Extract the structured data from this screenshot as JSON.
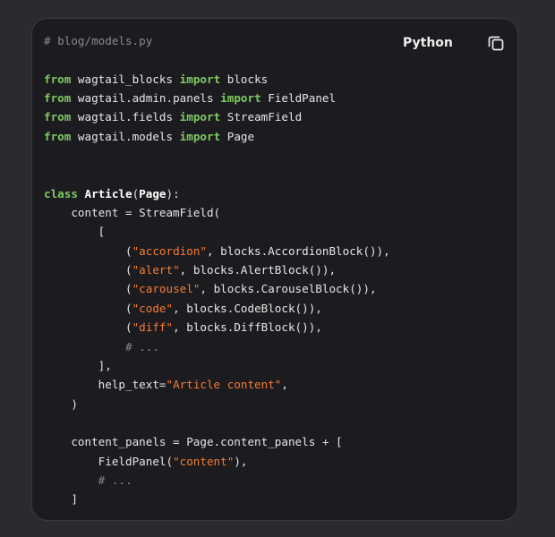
{
  "header": {
    "language": "Python",
    "copy_icon": "copy-icon"
  },
  "code": {
    "lines": [
      [
        {
          "t": "# blog/models.py",
          "k": "com"
        }
      ],
      [],
      [
        {
          "t": "from",
          "k": "kw"
        },
        {
          "t": " wagtail_blocks ",
          "k": "txt"
        },
        {
          "t": "import",
          "k": "kw"
        },
        {
          "t": " blocks",
          "k": "txt"
        }
      ],
      [
        {
          "t": "from",
          "k": "kw"
        },
        {
          "t": " wagtail.admin.panels ",
          "k": "txt"
        },
        {
          "t": "import",
          "k": "kw"
        },
        {
          "t": " FieldPanel",
          "k": "txt"
        }
      ],
      [
        {
          "t": "from",
          "k": "kw"
        },
        {
          "t": " wagtail.fields ",
          "k": "txt"
        },
        {
          "t": "import",
          "k": "kw"
        },
        {
          "t": " StreamField",
          "k": "txt"
        }
      ],
      [
        {
          "t": "from",
          "k": "kw"
        },
        {
          "t": " wagtail.models ",
          "k": "txt"
        },
        {
          "t": "import",
          "k": "kw"
        },
        {
          "t": " Page",
          "k": "txt"
        }
      ],
      [],
      [],
      [
        {
          "t": "class",
          "k": "kw"
        },
        {
          "t": " ",
          "k": "txt"
        },
        {
          "t": "Article",
          "k": "cls"
        },
        {
          "t": "(",
          "k": "txt"
        },
        {
          "t": "Page",
          "k": "cls"
        },
        {
          "t": "):",
          "k": "txt"
        }
      ],
      [
        {
          "t": "    content = StreamField(",
          "k": "txt"
        }
      ],
      [
        {
          "t": "        [",
          "k": "txt"
        }
      ],
      [
        {
          "t": "            (",
          "k": "txt"
        },
        {
          "t": "\"accordion\"",
          "k": "str"
        },
        {
          "t": ", blocks.AccordionBlock()),",
          "k": "txt"
        }
      ],
      [
        {
          "t": "            (",
          "k": "txt"
        },
        {
          "t": "\"alert\"",
          "k": "str"
        },
        {
          "t": ", blocks.AlertBlock()),",
          "k": "txt"
        }
      ],
      [
        {
          "t": "            (",
          "k": "txt"
        },
        {
          "t": "\"carousel\"",
          "k": "str"
        },
        {
          "t": ", blocks.CarouselBlock()),",
          "k": "txt"
        }
      ],
      [
        {
          "t": "            (",
          "k": "txt"
        },
        {
          "t": "\"code\"",
          "k": "str"
        },
        {
          "t": ", blocks.CodeBlock()),",
          "k": "txt"
        }
      ],
      [
        {
          "t": "            (",
          "k": "txt"
        },
        {
          "t": "\"diff\"",
          "k": "str"
        },
        {
          "t": ", blocks.DiffBlock()),",
          "k": "txt"
        }
      ],
      [
        {
          "t": "            # ...",
          "k": "com"
        }
      ],
      [
        {
          "t": "        ],",
          "k": "txt"
        }
      ],
      [
        {
          "t": "        help_text=",
          "k": "txt"
        },
        {
          "t": "\"Article content\"",
          "k": "str"
        },
        {
          "t": ",",
          "k": "txt"
        }
      ],
      [
        {
          "t": "    )",
          "k": "txt"
        }
      ],
      [],
      [
        {
          "t": "    content_panels = Page.content_panels + [",
          "k": "txt"
        }
      ],
      [
        {
          "t": "        FieldPanel(",
          "k": "txt"
        },
        {
          "t": "\"content\"",
          "k": "str"
        },
        {
          "t": "),",
          "k": "txt"
        }
      ],
      [
        {
          "t": "        # ...",
          "k": "com"
        }
      ],
      [
        {
          "t": "    ]",
          "k": "txt"
        }
      ]
    ]
  },
  "colors": {
    "page_background": "#2b2b2f",
    "card_background": "#1c1c20",
    "keyword": "#7fca62",
    "string": "#f47c34",
    "comment": "#888890",
    "text": "#e6e6e6"
  }
}
